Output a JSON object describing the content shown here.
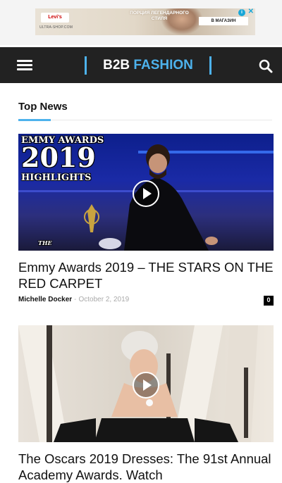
{
  "ad": {
    "brand": "Levi's",
    "site": "ULTRA-SHOP.COM",
    "text": "ПОРЦИЯ ЛЕГЕНДАРНОГО СТИЛЯ",
    "cta": "В МАГАЗИН",
    "info": "i",
    "close": "✕"
  },
  "header": {
    "logo_part1": "B2B ",
    "logo_part2": "FASHION",
    "accent": "#4db2ec"
  },
  "section": {
    "title": "Top News"
  },
  "articles": [
    {
      "overlay": {
        "line1": "EMMY AWARDS",
        "line2": "2019",
        "line3": "HIGHLIGHTS",
        "corner": "THE"
      },
      "title": "Emmy Awards 2019 – THE STARS ON THE RED CARPET",
      "author": "Michelle Docker",
      "separator": "-",
      "date": "October 2, 2019",
      "comments": "0"
    },
    {
      "title": "The Oscars 2019 Dresses: The 91st Annual Academy Awards. Watch"
    }
  ]
}
